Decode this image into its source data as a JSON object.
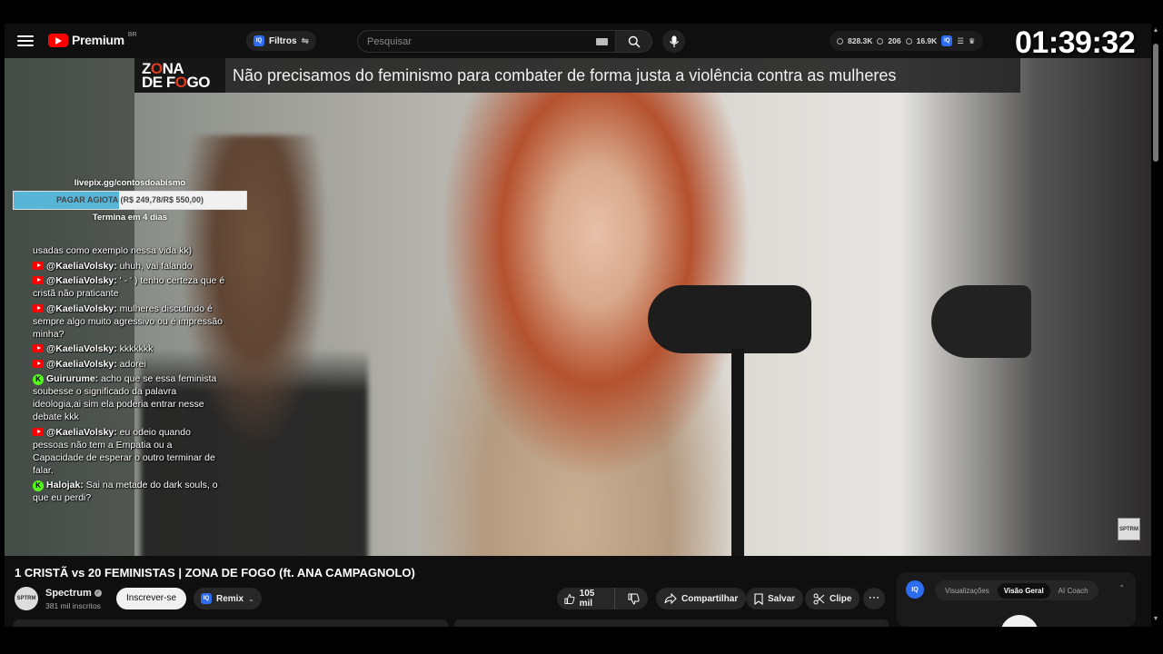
{
  "masthead": {
    "logo_text": "Premium",
    "logo_region": "BR",
    "filter_label": "Filtros",
    "iq_label": "IQ",
    "search_placeholder": "Pesquisar",
    "stats": [
      "828.3K",
      "206",
      "16.9K"
    ]
  },
  "overlay": {
    "clock": "01:39:32",
    "banner_logo_top": "ZONA",
    "banner_logo_bottom": "DE FOGO",
    "banner_text": "Não precisamos do feminismo para combater de forma justa a violência contra as mulheres",
    "donation": {
      "url": "livepix.gg/contosdoabismo",
      "label": "PAGAR AGIOTA (R$ 249,78/R$ 550,00)",
      "progress": 0.454,
      "ends": "Termina em 4 dias"
    },
    "watermark": "SPTRM",
    "chat": [
      {
        "platform": "",
        "author": "",
        "text": "usadas como exemplo nessa vida kk)"
      },
      {
        "platform": "youtube",
        "author": "@KaeliaVolsky:",
        "text": " uhuh, vai falando"
      },
      {
        "platform": "youtube",
        "author": "@KaeliaVolsky:",
        "text": " ' - ' ) tenho certeza que é cristã não praticante"
      },
      {
        "platform": "youtube",
        "author": "@KaeliaVolsky:",
        "text": " mulheres discutindo é sempre algo muito agressivo ou é impressão minha?"
      },
      {
        "platform": "youtube",
        "author": "@KaeliaVolsky:",
        "text": " kkkkkkk"
      },
      {
        "platform": "youtube",
        "author": "@KaeliaVolsky:",
        "text": " adorei"
      },
      {
        "platform": "kick",
        "author": "Guirurume:",
        "text": " acho que se essa feminista soubesse o significado da palavra ideologia,ai sim ela poderia entrar nesse debate kkk"
      },
      {
        "platform": "youtube",
        "author": "@KaeliaVolsky:",
        "text": " eu odeio quando pessoas não tem a Empatia ou a Capacidade de esperar o outro terminar de falar."
      },
      {
        "platform": "kick",
        "author": "Halojak:",
        "text": " Sai na metade do dark souls, o que eu perdi?"
      }
    ]
  },
  "video": {
    "title": "1 CRISTÃ vs 20 FEMINISTAS | ZONA DE FOGO (ft. ANA CAMPAGNOLO)",
    "channel_name": "Spectrum",
    "channel_avatar_text": "SPTRM",
    "subscribers": "381 mil inscritos",
    "subscribe_label": "Inscrever-se",
    "remix_label": "Remix",
    "likes": "105 mil",
    "share_label": "Compartilhar",
    "save_label": "Salvar",
    "clip_label": "Clipe"
  },
  "panel": {
    "iq_label": "IQ",
    "tabs": [
      "Visualizações",
      "Visão Geral",
      "AI Coach"
    ],
    "active_tab": 1
  },
  "colors": {
    "background": "#0f0f0f",
    "brand_red": "#ff0000",
    "iq_blue": "#2f6df0",
    "donation_fill": "#57b5d8",
    "kick_green": "#53fc18",
    "banner_accent": "#e23b1f"
  }
}
